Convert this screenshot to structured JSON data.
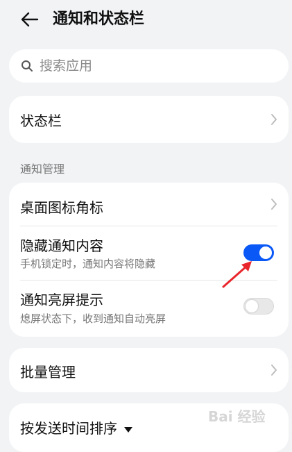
{
  "header": {
    "back_icon": "back-arrow-icon",
    "title": "通知和状态栏"
  },
  "search": {
    "placeholder": "搜索应用",
    "icon": "search-icon"
  },
  "status_bar": {
    "label": "状态栏"
  },
  "notification_management": {
    "section_label": "通知管理",
    "items": [
      {
        "label": "桌面图标角标"
      },
      {
        "label": "隐藏通知内容",
        "description": "手机锁定时，通知内容将隐藏",
        "toggle": "on"
      },
      {
        "label": "通知亮屏提示",
        "description": "熄屏状态下，收到通知自动亮屏",
        "toggle": "off"
      }
    ]
  },
  "batch": {
    "label": "批量管理"
  },
  "sort": {
    "label": "按发送时间排序"
  },
  "watermark": {
    "text": "Bai 经验"
  },
  "colors": {
    "background": "#f1f3f5",
    "card": "#ffffff",
    "accent": "#0a59f7",
    "annotation_arrow": "#e8262c"
  }
}
